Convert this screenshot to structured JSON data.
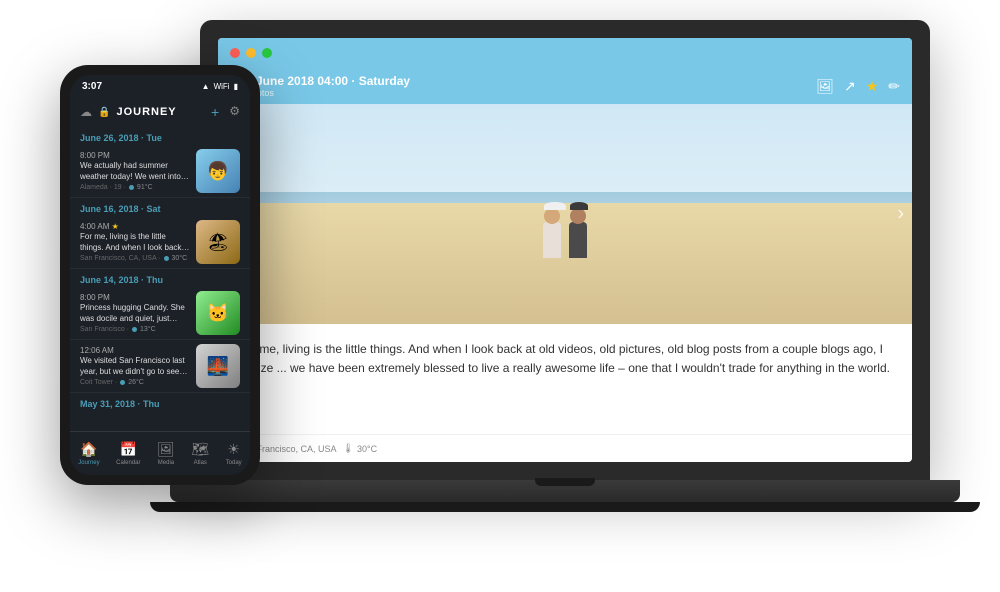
{
  "scene": {
    "background": "#ffffff"
  },
  "laptop": {
    "titlebar": {
      "traffic_lights": [
        "red",
        "yellow",
        "green"
      ]
    },
    "entry": {
      "date": "16 June 2018 04:00 · Saturday",
      "photos_count": "3 photos",
      "text": "For me, living is the little things. And when I look back at old videos, old pictures, old blog posts from a couple blogs ago, I realize ... we have been extremely blessed to live a really awesome life – one that I wouldn't trade for anything in the world.",
      "location": "San Francisco, CA, USA",
      "temperature": "30°C"
    }
  },
  "phone": {
    "statusbar": {
      "time": "3:07",
      "signal": "●●●",
      "wifi": "WiFi",
      "battery": "▮"
    },
    "nav": {
      "app_name": "JOURNEY",
      "add_label": "+",
      "settings_label": "⚙"
    },
    "entries": [
      {
        "date_header": "June 26, 2018 · Tue",
        "time": "8:00 PM",
        "text": "We actually had summer weather today! We went into town for a stroll, and I pic...",
        "location": "Alameda · 19 · 91°C",
        "has_image": true,
        "img_class": "img1"
      },
      {
        "date_header": "June 16, 2018 · Sat",
        "time": "4:00 AM",
        "text": "For me, living is the little things. And when I look back at old videos, old...",
        "location": "San Francisco, CA, USA · 30°C",
        "has_image": true,
        "img_class": "img2",
        "starred": true
      },
      {
        "date_header": "June 14, 2018 · Thu",
        "time": "8:00 PM",
        "text": "Princess hugging Candy. She was docile and quiet, just settling into her arms wi...",
        "location": "San Francisco · 13°C",
        "has_image": true,
        "img_class": "img3"
      },
      {
        "date_header": "",
        "time": "12:06 AM",
        "text": "We visited San Francisco last year, but we didn't go to see the Golden Gate Brid...",
        "location": "Coit Tower · 26°C",
        "has_image": true,
        "img_class": "img4"
      },
      {
        "date_header": "May 31, 2018 · Thu",
        "time": "",
        "text": "",
        "location": "",
        "has_image": false,
        "img_class": ""
      }
    ],
    "tabs": [
      {
        "label": "Journey",
        "icon": "🏠",
        "active": true
      },
      {
        "label": "Calendar",
        "icon": "📅",
        "active": false
      },
      {
        "label": "Media",
        "icon": "🖼",
        "active": false
      },
      {
        "label": "Atlas",
        "icon": "🗺",
        "active": false
      },
      {
        "label": "Today",
        "icon": "☀",
        "active": false
      }
    ]
  },
  "app_title": "JouRNey"
}
